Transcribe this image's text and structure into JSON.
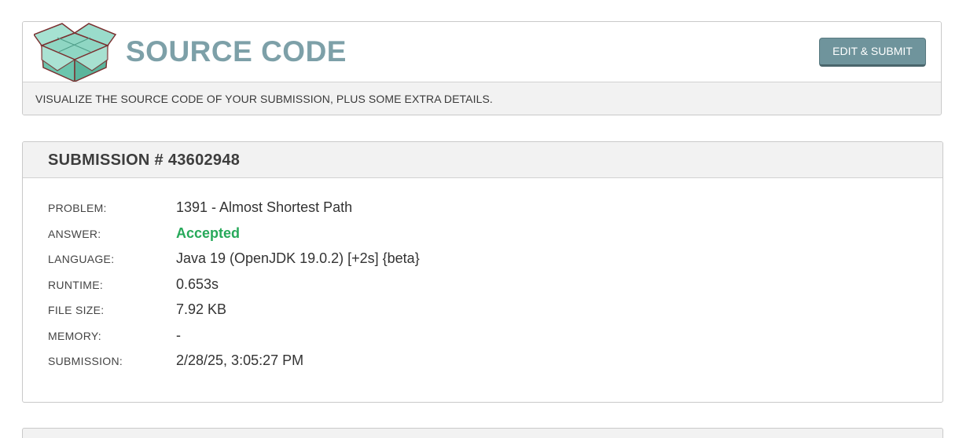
{
  "header": {
    "title": "SOURCE CODE",
    "edit_button": "EDIT & SUBMIT",
    "description": "VISUALIZE THE SOURCE CODE OF YOUR SUBMISSION, PLUS SOME EXTRA DETAILS.",
    "logo_icon": "open-box-icon"
  },
  "submission": {
    "title": "SUBMISSION # 43602948",
    "rows": [
      {
        "label": "PROBLEM:",
        "value": "1391 - Almost Shortest Path"
      },
      {
        "label": "ANSWER:",
        "value": "Accepted"
      },
      {
        "label": "LANGUAGE:",
        "value": "Java 19 (OpenJDK 19.0.2) [+2s] {beta}"
      },
      {
        "label": "RUNTIME:",
        "value": "0.653s"
      },
      {
        "label": "FILE SIZE:",
        "value": "7.92 KB"
      },
      {
        "label": "MEMORY:",
        "value": "-"
      },
      {
        "label": "SUBMISSION:",
        "value": "2/28/25, 3:05:27 PM"
      }
    ]
  },
  "colors": {
    "title": "#7da0a8",
    "button": "#6f949c",
    "accepted": "#27a95a",
    "panel_bg": "#f2f2f2"
  }
}
